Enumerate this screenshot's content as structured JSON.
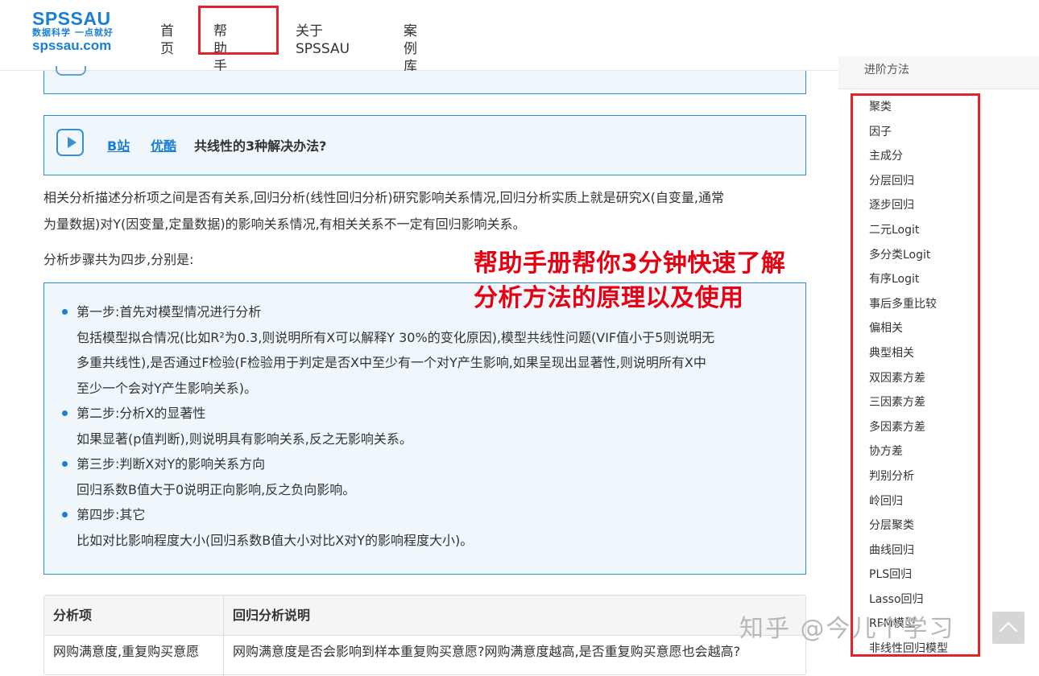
{
  "header": {
    "logo": {
      "main": "SPSSAU",
      "slogan": "数据科学 一点就好",
      "domain": "spssau.com"
    },
    "nav": [
      {
        "label": "首页"
      },
      {
        "label": "帮助手册"
      },
      {
        "label": "关于SPSSAU"
      },
      {
        "label": "案例库"
      }
    ]
  },
  "video": {
    "links": [
      "B站",
      "优酷"
    ],
    "title": "共线性的3种解决办法?"
  },
  "intro": {
    "line1": "相关分析描述分析项之间是否有关系,回归分析(线性回归分析)研究影响关系情况,回归分析实质上就是研究X(自变量,通常",
    "line2": "为量数据)对Y(因变量,定量数据)的影响关系情况,有相关关系不一定有回归影响关系。",
    "steps_intro": "分析步骤共为四步,分别是:"
  },
  "steps": [
    {
      "title": "第一步:首先对模型情况进行分析",
      "desc": [
        "包括模型拟合情况(比如R²为0.3,则说明所有X可以解释Y 30%的变化原因),模型共线性问题(VIF值小于5则说明无",
        "多重共线性),是否通过F检验(F检验用于判定是否X中至少有一个对Y产生影响,如果呈现出显著性,则说明所有X中",
        "至少一个会对Y产生影响关系)。"
      ]
    },
    {
      "title": "第二步:分析X的显著性",
      "desc": [
        "如果显著(p值判断),则说明具有影响关系,反之无影响关系。"
      ]
    },
    {
      "title": "第三步:判断X对Y的影响关系方向",
      "desc": [
        "回归系数B值大于0说明正向影响,反之负向影响。"
      ]
    },
    {
      "title": "第四步:其它",
      "desc": [
        "比如对比影响程度大小(回归系数B值大小对比X对Y的影响程度大小)。"
      ]
    }
  ],
  "table": {
    "headers": [
      "分析项",
      "回归分析说明"
    ],
    "rows": [
      [
        "网购满意度,重复购买意愿",
        "网购满意度是否会影响到样本重复购买意愿?网购满意度越高,是否重复购买意愿也会越高?"
      ]
    ]
  },
  "annotation": {
    "line1": "帮助手册帮你3分钟快速了解",
    "line2": "分析方法的原理以及使用"
  },
  "sidebar": {
    "heading": "进阶方法",
    "items": [
      "聚类",
      "因子",
      "主成分",
      "分层回归",
      "逐步回归",
      "二元Logit",
      "多分类Logit",
      "有序Logit",
      "事后多重比较",
      "偏相关",
      "典型相关",
      "双因素方差",
      "三因素方差",
      "多因素方差",
      "协方差",
      "判别分析",
      "岭回归",
      "分层聚类",
      "曲线回归",
      "PLS回归",
      "Lasso回归",
      "RFM模型",
      "非线性回归模型"
    ]
  },
  "watermark": "知乎 @今儿个学习",
  "colors": {
    "brand": "#1a7fd4",
    "highlight": "#e0242b",
    "annotation": "#e60012",
    "box_bg": "#eff7fc",
    "box_border": "#2b8fc9"
  }
}
